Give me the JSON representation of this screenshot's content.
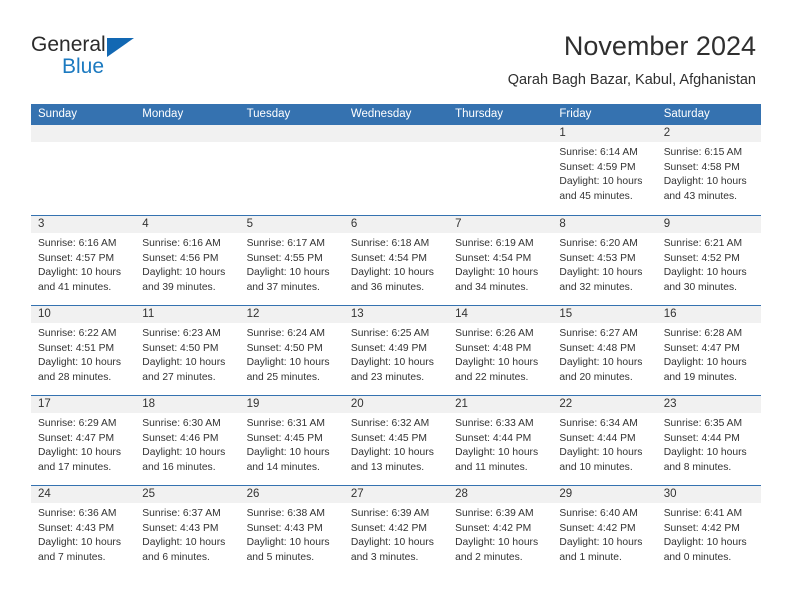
{
  "brand": {
    "name_top": "General",
    "name_bottom": "Blue",
    "accent_color": "#1c7ac0",
    "triangle_color": "#1268b3"
  },
  "header": {
    "title": "November 2024",
    "location": "Qarah Bagh Bazar, Kabul, Afghanistan"
  },
  "calendar": {
    "header_bg": "#3572b0",
    "day_band_bg": "#f1f1f1",
    "weekdays": [
      "Sunday",
      "Monday",
      "Tuesday",
      "Wednesday",
      "Thursday",
      "Friday",
      "Saturday"
    ],
    "weeks": [
      [
        {
          "day": "",
          "empty": true
        },
        {
          "day": "",
          "empty": true
        },
        {
          "day": "",
          "empty": true
        },
        {
          "day": "",
          "empty": true
        },
        {
          "day": "",
          "empty": true
        },
        {
          "day": "1",
          "sunrise": "Sunrise: 6:14 AM",
          "sunset": "Sunset: 4:59 PM",
          "daylight": "Daylight: 10 hours and 45 minutes."
        },
        {
          "day": "2",
          "sunrise": "Sunrise: 6:15 AM",
          "sunset": "Sunset: 4:58 PM",
          "daylight": "Daylight: 10 hours and 43 minutes."
        }
      ],
      [
        {
          "day": "3",
          "sunrise": "Sunrise: 6:16 AM",
          "sunset": "Sunset: 4:57 PM",
          "daylight": "Daylight: 10 hours and 41 minutes."
        },
        {
          "day": "4",
          "sunrise": "Sunrise: 6:16 AM",
          "sunset": "Sunset: 4:56 PM",
          "daylight": "Daylight: 10 hours and 39 minutes."
        },
        {
          "day": "5",
          "sunrise": "Sunrise: 6:17 AM",
          "sunset": "Sunset: 4:55 PM",
          "daylight": "Daylight: 10 hours and 37 minutes."
        },
        {
          "day": "6",
          "sunrise": "Sunrise: 6:18 AM",
          "sunset": "Sunset: 4:54 PM",
          "daylight": "Daylight: 10 hours and 36 minutes."
        },
        {
          "day": "7",
          "sunrise": "Sunrise: 6:19 AM",
          "sunset": "Sunset: 4:54 PM",
          "daylight": "Daylight: 10 hours and 34 minutes."
        },
        {
          "day": "8",
          "sunrise": "Sunrise: 6:20 AM",
          "sunset": "Sunset: 4:53 PM",
          "daylight": "Daylight: 10 hours and 32 minutes."
        },
        {
          "day": "9",
          "sunrise": "Sunrise: 6:21 AM",
          "sunset": "Sunset: 4:52 PM",
          "daylight": "Daylight: 10 hours and 30 minutes."
        }
      ],
      [
        {
          "day": "10",
          "sunrise": "Sunrise: 6:22 AM",
          "sunset": "Sunset: 4:51 PM",
          "daylight": "Daylight: 10 hours and 28 minutes."
        },
        {
          "day": "11",
          "sunrise": "Sunrise: 6:23 AM",
          "sunset": "Sunset: 4:50 PM",
          "daylight": "Daylight: 10 hours and 27 minutes."
        },
        {
          "day": "12",
          "sunrise": "Sunrise: 6:24 AM",
          "sunset": "Sunset: 4:50 PM",
          "daylight": "Daylight: 10 hours and 25 minutes."
        },
        {
          "day": "13",
          "sunrise": "Sunrise: 6:25 AM",
          "sunset": "Sunset: 4:49 PM",
          "daylight": "Daylight: 10 hours and 23 minutes."
        },
        {
          "day": "14",
          "sunrise": "Sunrise: 6:26 AM",
          "sunset": "Sunset: 4:48 PM",
          "daylight": "Daylight: 10 hours and 22 minutes."
        },
        {
          "day": "15",
          "sunrise": "Sunrise: 6:27 AM",
          "sunset": "Sunset: 4:48 PM",
          "daylight": "Daylight: 10 hours and 20 minutes."
        },
        {
          "day": "16",
          "sunrise": "Sunrise: 6:28 AM",
          "sunset": "Sunset: 4:47 PM",
          "daylight": "Daylight: 10 hours and 19 minutes."
        }
      ],
      [
        {
          "day": "17",
          "sunrise": "Sunrise: 6:29 AM",
          "sunset": "Sunset: 4:47 PM",
          "daylight": "Daylight: 10 hours and 17 minutes."
        },
        {
          "day": "18",
          "sunrise": "Sunrise: 6:30 AM",
          "sunset": "Sunset: 4:46 PM",
          "daylight": "Daylight: 10 hours and 16 minutes."
        },
        {
          "day": "19",
          "sunrise": "Sunrise: 6:31 AM",
          "sunset": "Sunset: 4:45 PM",
          "daylight": "Daylight: 10 hours and 14 minutes."
        },
        {
          "day": "20",
          "sunrise": "Sunrise: 6:32 AM",
          "sunset": "Sunset: 4:45 PM",
          "daylight": "Daylight: 10 hours and 13 minutes."
        },
        {
          "day": "21",
          "sunrise": "Sunrise: 6:33 AM",
          "sunset": "Sunset: 4:44 PM",
          "daylight": "Daylight: 10 hours and 11 minutes."
        },
        {
          "day": "22",
          "sunrise": "Sunrise: 6:34 AM",
          "sunset": "Sunset: 4:44 PM",
          "daylight": "Daylight: 10 hours and 10 minutes."
        },
        {
          "day": "23",
          "sunrise": "Sunrise: 6:35 AM",
          "sunset": "Sunset: 4:44 PM",
          "daylight": "Daylight: 10 hours and 8 minutes."
        }
      ],
      [
        {
          "day": "24",
          "sunrise": "Sunrise: 6:36 AM",
          "sunset": "Sunset: 4:43 PM",
          "daylight": "Daylight: 10 hours and 7 minutes."
        },
        {
          "day": "25",
          "sunrise": "Sunrise: 6:37 AM",
          "sunset": "Sunset: 4:43 PM",
          "daylight": "Daylight: 10 hours and 6 minutes."
        },
        {
          "day": "26",
          "sunrise": "Sunrise: 6:38 AM",
          "sunset": "Sunset: 4:43 PM",
          "daylight": "Daylight: 10 hours and 5 minutes."
        },
        {
          "day": "27",
          "sunrise": "Sunrise: 6:39 AM",
          "sunset": "Sunset: 4:42 PM",
          "daylight": "Daylight: 10 hours and 3 minutes."
        },
        {
          "day": "28",
          "sunrise": "Sunrise: 6:39 AM",
          "sunset": "Sunset: 4:42 PM",
          "daylight": "Daylight: 10 hours and 2 minutes."
        },
        {
          "day": "29",
          "sunrise": "Sunrise: 6:40 AM",
          "sunset": "Sunset: 4:42 PM",
          "daylight": "Daylight: 10 hours and 1 minute."
        },
        {
          "day": "30",
          "sunrise": "Sunrise: 6:41 AM",
          "sunset": "Sunset: 4:42 PM",
          "daylight": "Daylight: 10 hours and 0 minutes."
        }
      ]
    ]
  }
}
